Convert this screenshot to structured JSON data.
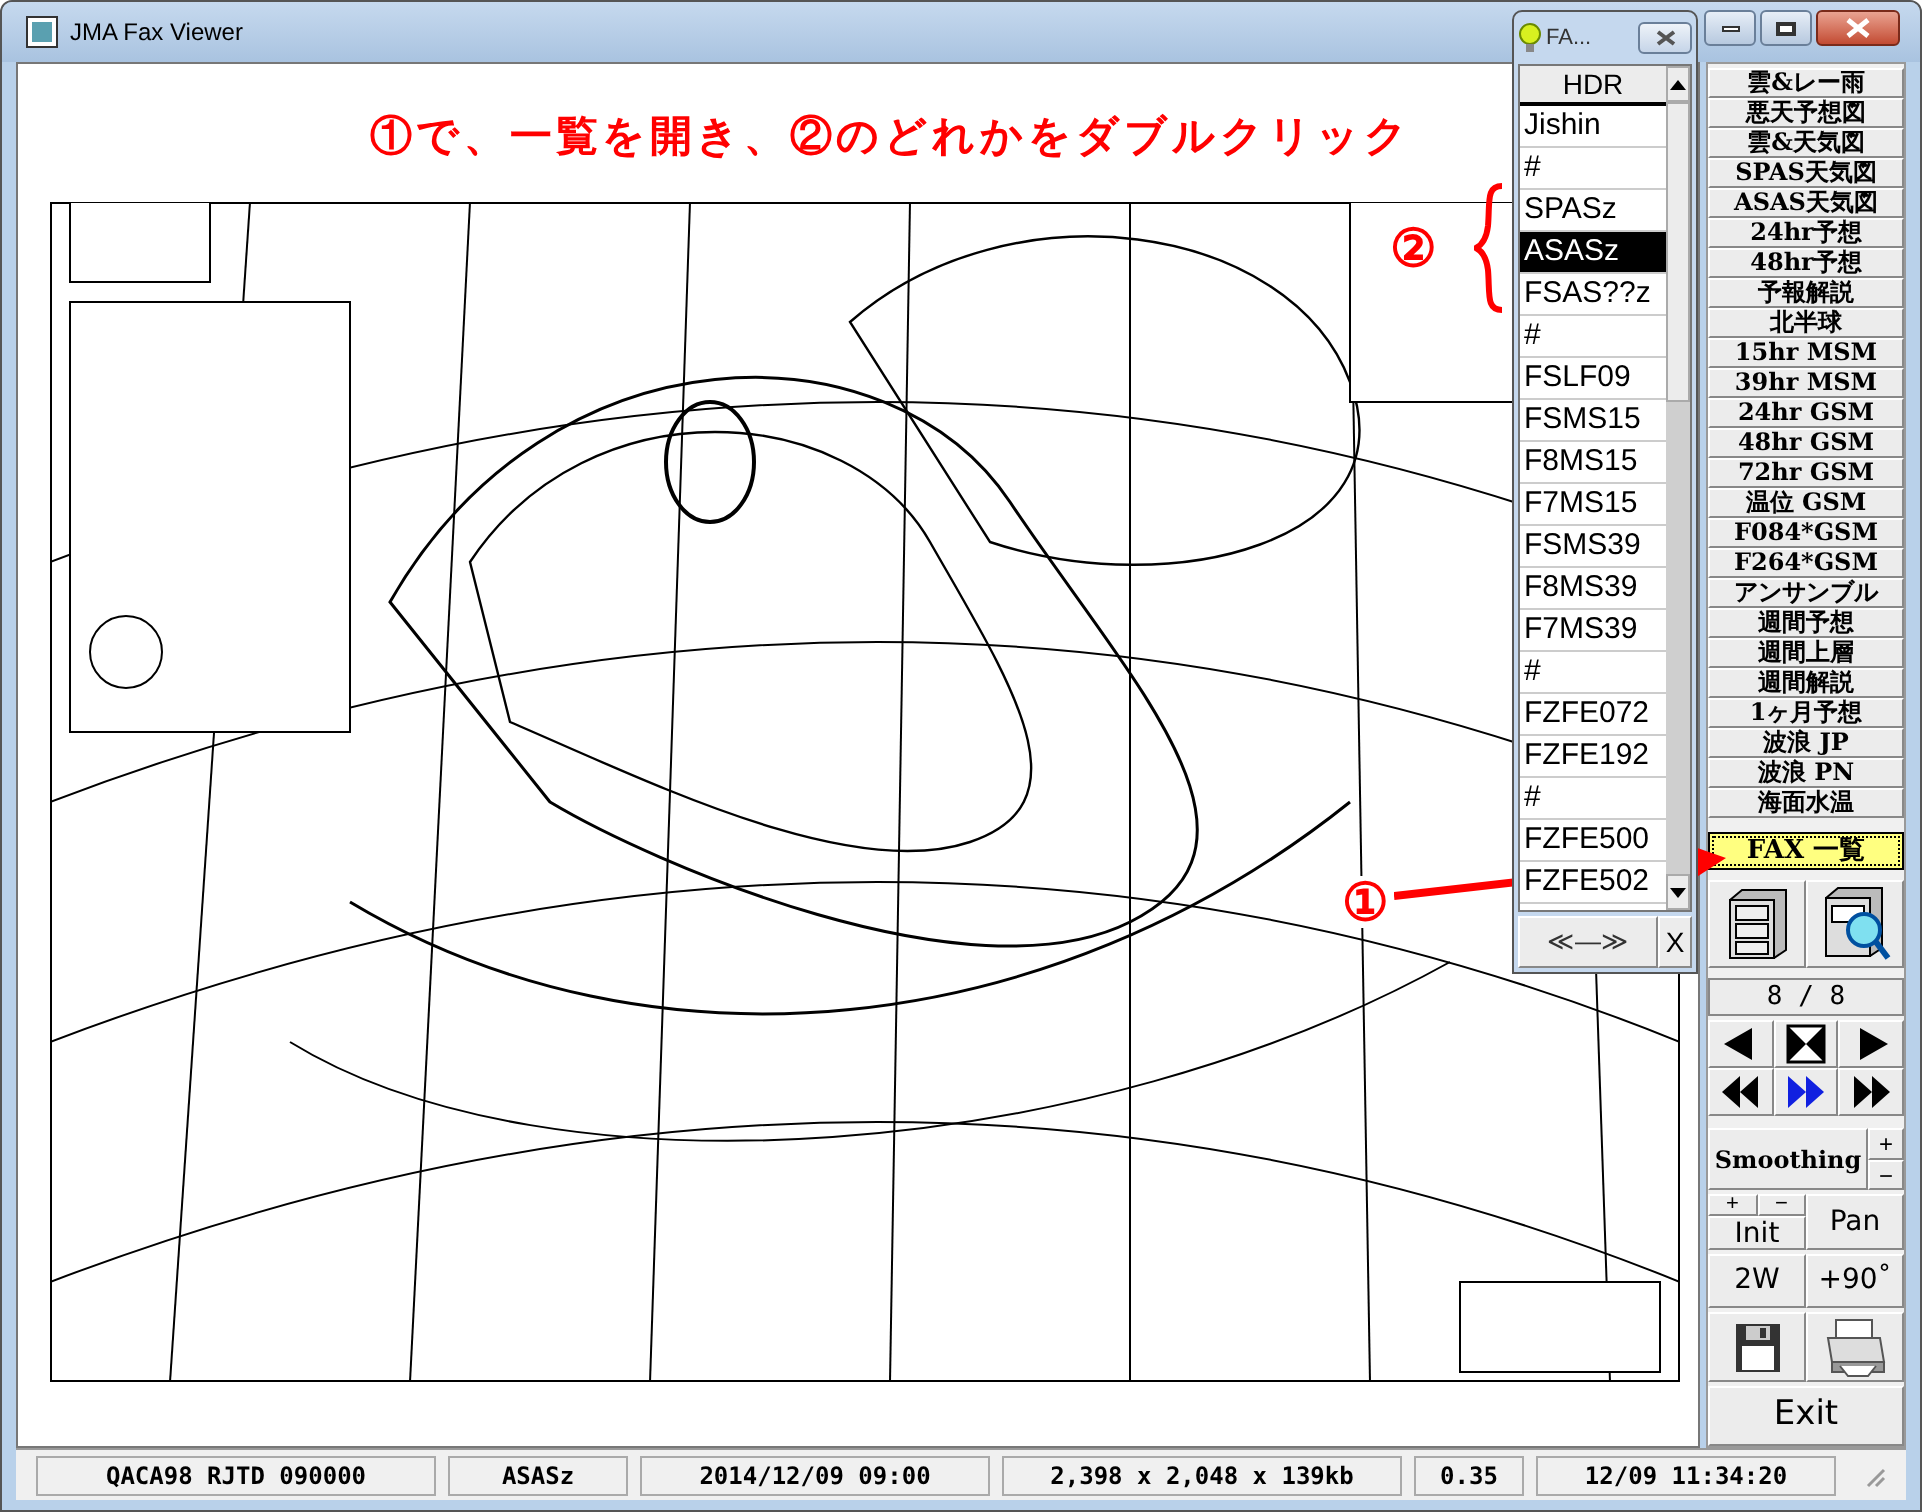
{
  "window": {
    "title": "JMA Fax Viewer"
  },
  "annotation": {
    "instruction": "①で、一覧を開き、②のどれかをダブルクリック",
    "marker_1": "①",
    "marker_2": "②"
  },
  "popup": {
    "title": "FA...",
    "header": "HDR",
    "items": [
      {
        "label": "Jishin",
        "selected": false
      },
      {
        "label": "#",
        "selected": false
      },
      {
        "label": "SPASz",
        "selected": false
      },
      {
        "label": "ASASz",
        "selected": true
      },
      {
        "label": "FSAS??z",
        "selected": false
      },
      {
        "label": "#",
        "selected": false
      },
      {
        "label": "FSLF09",
        "selected": false
      },
      {
        "label": "FSMS15",
        "selected": false
      },
      {
        "label": "F8MS15",
        "selected": false
      },
      {
        "label": "F7MS15",
        "selected": false
      },
      {
        "label": "FSMS39",
        "selected": false
      },
      {
        "label": "F8MS39",
        "selected": false
      },
      {
        "label": "F7MS39",
        "selected": false
      },
      {
        "label": "#",
        "selected": false
      },
      {
        "label": "FZFE072",
        "selected": false
      },
      {
        "label": "FZFE192",
        "selected": false
      },
      {
        "label": "#",
        "selected": false
      },
      {
        "label": "FZFE500",
        "selected": false
      },
      {
        "label": "FZFE502",
        "selected": false
      }
    ],
    "prev_next": "≪—≫",
    "close": "X"
  },
  "categories": [
    "雲&レー雨",
    "悪天予想図",
    "雲&天気図",
    "SPAS天気図",
    "ASAS天気図",
    "24hr予想",
    "48hr予想",
    "予報解説",
    "北半球",
    "15hr MSM",
    "39hr MSM",
    "24hr GSM",
    "48hr GSM",
    "72hr GSM",
    "温位 GSM",
    "F084*GSM",
    "F264*GSM",
    "アンサンブル",
    "週間予想",
    "週間上層",
    "週間解説",
    "1ヶ月予想",
    "波浪 JP",
    "波浪 PN",
    "海面水温"
  ],
  "fax_list_button": "FAX 一覧",
  "counter": "8 / 8",
  "nav_buttons": [
    {
      "kind": "prev",
      "active": false
    },
    {
      "kind": "fit",
      "active": false
    },
    {
      "kind": "next",
      "active": false
    },
    {
      "kind": "rewind",
      "active": false
    },
    {
      "kind": "forward",
      "active": true
    },
    {
      "kind": "end",
      "active": false
    }
  ],
  "smoothing": {
    "label": "Smoothing",
    "plus": "+",
    "minus": "−"
  },
  "zoom": {
    "plus": "+",
    "minus": "−",
    "init": "Init"
  },
  "pan": "Pan",
  "two_window": "2W",
  "rotate": "+90˚",
  "exit": "Exit",
  "status_bar": [
    "QACA98 RJTD 090000",
    "ASASz",
    "2014/12/09 09:00",
    "2,398 x 2,048 x 139kb",
    "0.35",
    "12/09 11:34:20"
  ]
}
